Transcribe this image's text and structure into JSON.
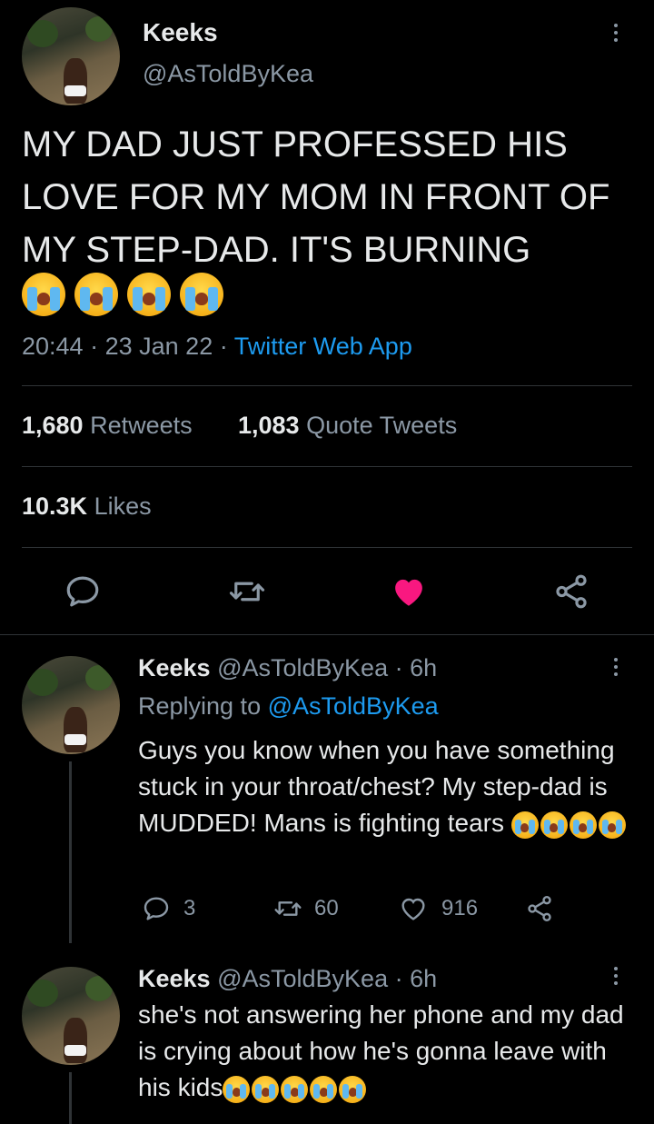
{
  "main_tweet": {
    "display_name": "Keeks",
    "handle": "@AsToldByKea",
    "text": "MY DAD JUST PROFESSED HIS LOVE FOR MY MOM IN FRONT OF MY STEP-DAD. IT'S BURNING",
    "emoji_count": 4,
    "time": "20:44",
    "separator": "·",
    "date": "23 Jan 22",
    "source": "Twitter Web App",
    "retweets_count": "1,680",
    "retweets_label": "Retweets",
    "quotes_count": "1,083",
    "quotes_label": "Quote Tweets",
    "likes_count": "10.3K",
    "likes_label": "Likes",
    "liked": true,
    "like_color": "#f91880"
  },
  "replies": [
    {
      "display_name": "Keeks",
      "handle": "@AsToldByKea",
      "age": "· 6h",
      "replying_prefix": "Replying to",
      "replying_to": "@AsToldByKea",
      "text": "Guys you know when you have something stuck in your throat/chest? My step-dad is MUDDED! Mans is fighting tears",
      "emoji_count": 4,
      "reply_count": "3",
      "retweet_count": "60",
      "like_count": "916"
    },
    {
      "display_name": "Keeks",
      "handle": "@AsToldByKea",
      "age": "· 6h",
      "text": "she's not answering her phone and my dad is crying about how he's gonna leave with his kids",
      "emoji_count": 5
    }
  ],
  "colors": {
    "background": "#000000",
    "text": "#e7e9ea",
    "muted": "#8b98a5",
    "link": "#1d9bf0",
    "divider": "#2f3336"
  }
}
